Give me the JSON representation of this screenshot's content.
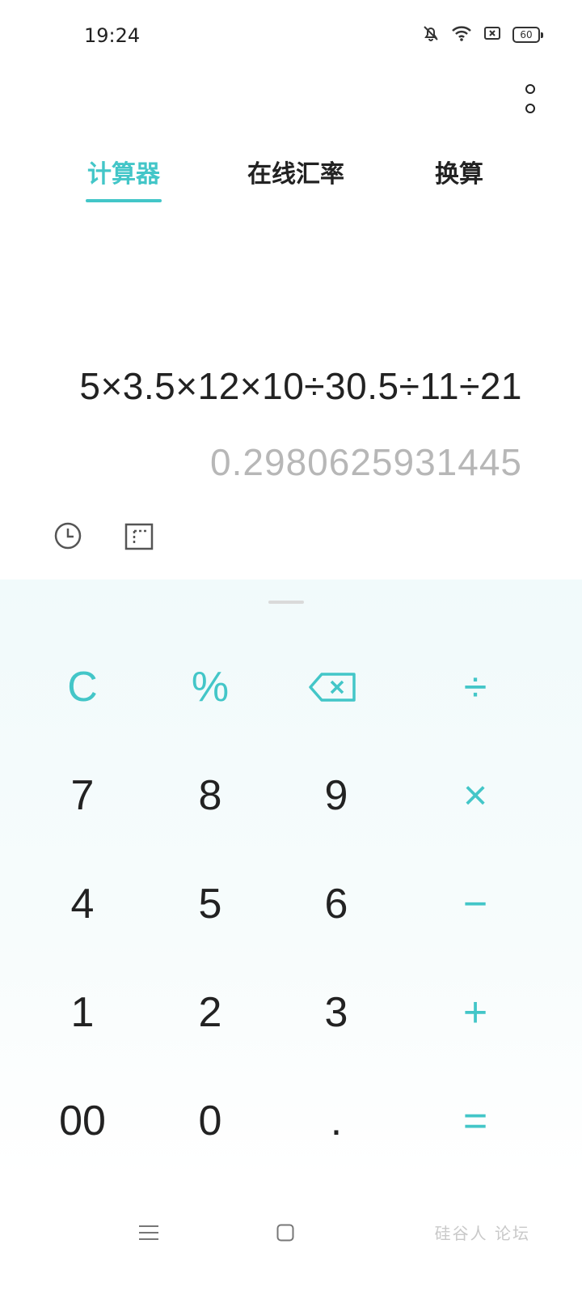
{
  "status_bar": {
    "time": "19:24",
    "battery": "60",
    "icons": [
      "bell-off-icon",
      "wifi-icon",
      "sim-off-icon",
      "battery-icon"
    ]
  },
  "tabs": [
    {
      "label": "计算器",
      "active": true
    },
    {
      "label": "在线汇率",
      "active": false
    },
    {
      "label": "换算",
      "active": false
    }
  ],
  "display": {
    "expression": "5×3.5×12×10÷30.5÷11÷21",
    "result": "0.2980625931445"
  },
  "keypad": {
    "clear": "C",
    "percent": "%",
    "divide": "÷",
    "multiply": "×",
    "minus": "−",
    "plus": "+",
    "equals": "=",
    "digits": {
      "seven": "7",
      "eight": "8",
      "nine": "9",
      "four": "4",
      "five": "5",
      "six": "6",
      "one": "1",
      "two": "2",
      "three": "3",
      "double_zero": "00",
      "zero": "0",
      "dot": "."
    }
  },
  "watermark": "硅谷人 论坛",
  "colors": {
    "accent": "#43c6c8",
    "text": "#222222",
    "result": "#b7b7b7",
    "keypad_bg": "#f1fafb"
  }
}
